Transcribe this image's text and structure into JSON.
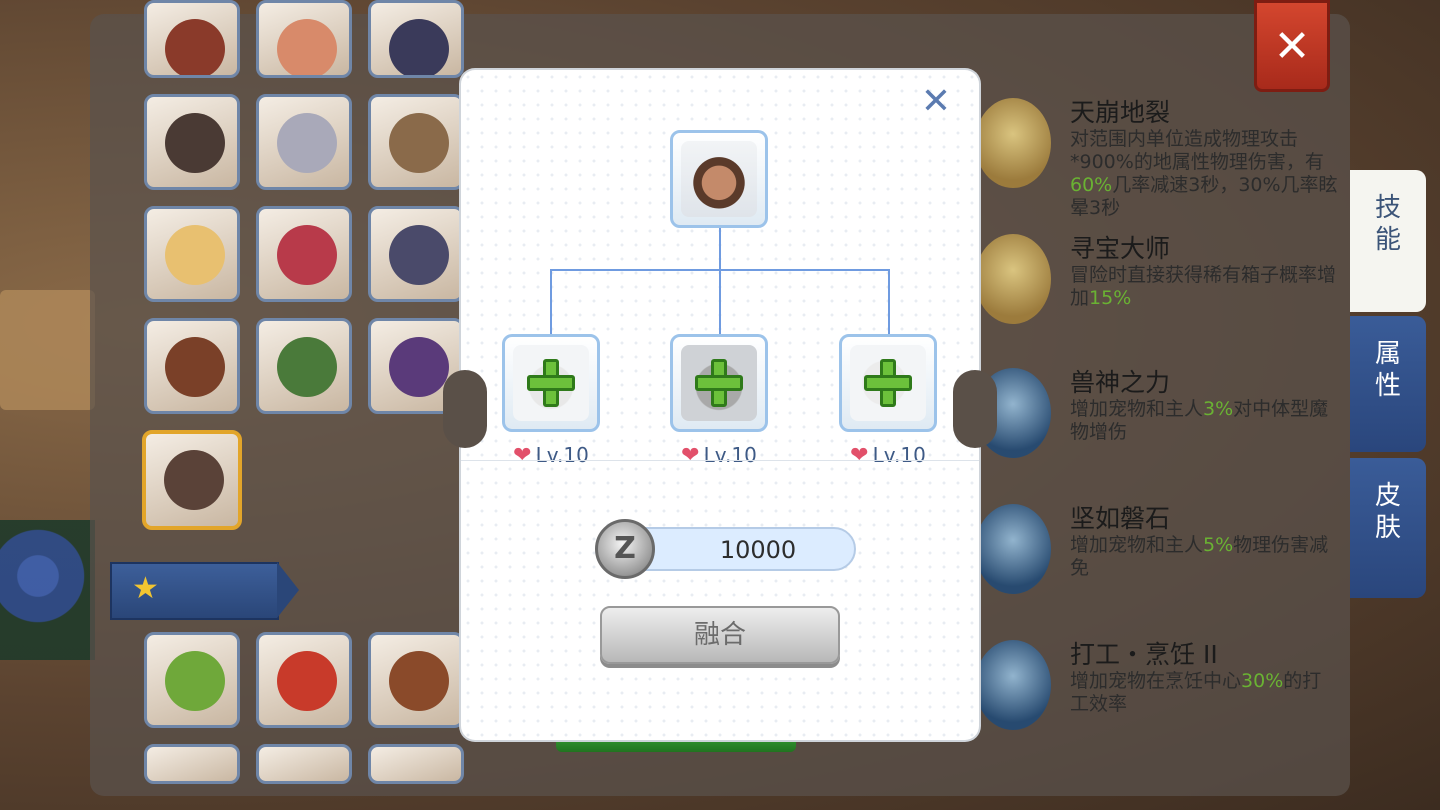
{
  "colors": {
    "accent_blue": "#2a467c",
    "highlight_green": "#6ab233",
    "close_red": "#c23a24"
  },
  "pet_grid": {
    "pets": [
      "pet-1",
      "pet-2",
      "pet-3",
      "pet-4",
      "pet-5",
      "pet-6",
      "pet-7",
      "pet-8",
      "pet-9",
      "pet-10",
      "pet-11",
      "pet-12",
      "pet-13",
      "pet-14",
      "pet-15",
      "pet-16",
      "pet-17",
      "pet-18"
    ],
    "star_icon": "★"
  },
  "skills": [
    {
      "name": "天崩地裂",
      "desc_a": "对范围内单位造成物理攻击*900%的地属性物理伤害，有",
      "desc_b": "60%",
      "desc_c": "几率减速3秒，30%几率眩晕3秒"
    },
    {
      "name": "寻宝大师",
      "desc_a": "冒险时直接获得稀有箱子概率增加",
      "desc_b": "15%",
      "desc_c": ""
    },
    {
      "name": "兽神之力",
      "desc_a": "增加宠物和主人",
      "desc_b": "3%",
      "desc_c": "对中体型魔物增伤"
    },
    {
      "name": "坚如磐石",
      "desc_a": "增加宠物和主人",
      "desc_b": "5%",
      "desc_c": "物理伤害减免"
    },
    {
      "name": "打工・烹饪 II",
      "desc_a": "增加宠物在烹饪中心",
      "desc_b": "30%",
      "desc_c": "的打工效率"
    }
  ],
  "side_tabs": [
    "技能",
    "属性",
    "皮肤"
  ],
  "modal": {
    "close_icon": "✕",
    "materials": [
      {
        "level": "Lv.10"
      },
      {
        "level": "Lv.10"
      },
      {
        "level": "Lv.10"
      }
    ],
    "heart_icon": "❤",
    "cost": "10000",
    "coin_symbol": "Z",
    "fuse_button": "融合"
  },
  "panel_close_icon": "✕"
}
